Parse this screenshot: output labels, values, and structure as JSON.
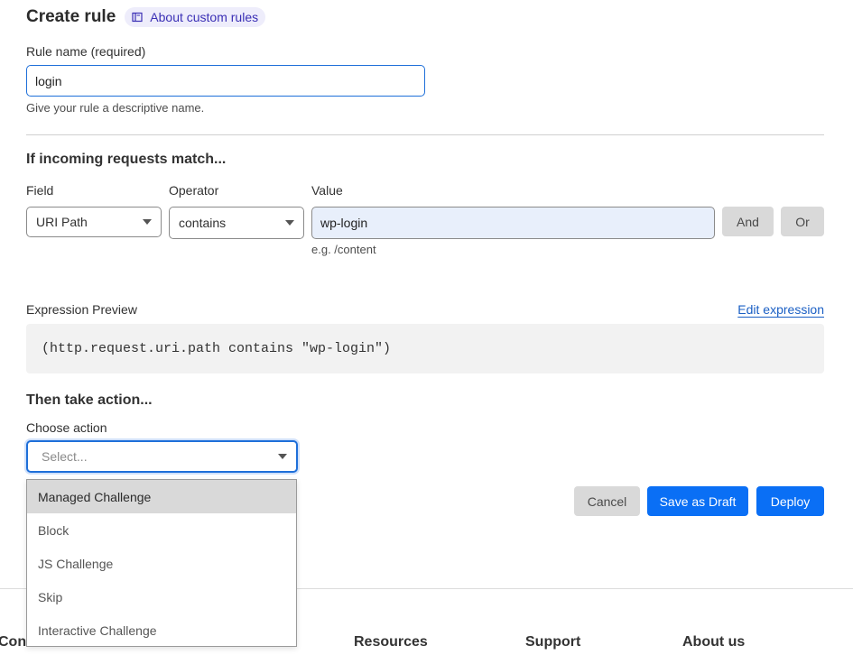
{
  "header": {
    "title": "Create rule",
    "about_link": "About custom rules"
  },
  "rule_name": {
    "label": "Rule name (required)",
    "value": "login",
    "help": "Give your rule a descriptive name."
  },
  "match": {
    "heading": "If incoming requests match...",
    "field_label": "Field",
    "field_value": "URI Path",
    "operator_label": "Operator",
    "operator_value": "contains",
    "value_label": "Value",
    "value": "wp-login",
    "value_example": "e.g. /content",
    "and_label": "And",
    "or_label": "Or"
  },
  "expression": {
    "label": "Expression Preview",
    "edit_link": "Edit expression",
    "preview": "(http.request.uri.path contains \"wp-login\")"
  },
  "action": {
    "heading": "Then take action...",
    "label": "Choose action",
    "placeholder": "Select...",
    "options": [
      "Managed Challenge",
      "Block",
      "JS Challenge",
      "Skip",
      "Interactive Challenge"
    ],
    "highlighted_index": 0
  },
  "buttons": {
    "cancel": "Cancel",
    "save_draft": "Save as Draft",
    "deploy": "Deploy"
  },
  "footer": {
    "col1": "Cont",
    "col2": "Resources",
    "col3": "Support",
    "col4": "About us"
  },
  "colors": {
    "accent": "#0a6ff5",
    "link": "#1a5fc4"
  }
}
